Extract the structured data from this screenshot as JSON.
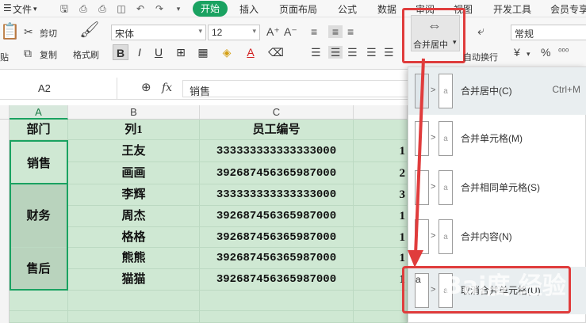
{
  "menu": {
    "file": "文件",
    "tabs": [
      "开始",
      "插入",
      "页面布局",
      "公式",
      "数据",
      "审阅",
      "视图",
      "开发工具",
      "会员专享"
    ]
  },
  "ribbon": {
    "cut": "剪切",
    "paste": "贴",
    "copy": "复制",
    "format_painter": "格式刷",
    "font_name": "宋体",
    "font_size": "12",
    "bold": "B",
    "italic": "I",
    "underline": "U",
    "merge_center": "合并居中",
    "auto_wrap": "自动换行",
    "number_format": "常规",
    "currency": "¥",
    "percent": "%"
  },
  "formula_bar": {
    "name_box": "A2",
    "fx": "fx",
    "content": "销售"
  },
  "columns": [
    "A",
    "B",
    "C"
  ],
  "table": {
    "headers": [
      "部门",
      "列1",
      "员工编号"
    ],
    "groups": [
      "销售",
      "财务",
      "售后"
    ],
    "names": [
      "王友",
      "画画",
      "李辉",
      "周杰",
      "格格",
      "熊熊",
      "猫猫"
    ],
    "ids": [
      "333333333333333000",
      "392687456365987000",
      "333333333333333000",
      "392687456365987000",
      "392687456365987000",
      "392687456365987000",
      "392687456365987000"
    ],
    "col_d_partial": [
      "1",
      "2",
      "3",
      "1",
      "1",
      "1",
      "1"
    ]
  },
  "dropdown": {
    "items": [
      {
        "label": "合并居中(C)",
        "shortcut": "Ctrl+M"
      },
      {
        "label": "合并单元格(M)",
        "shortcut": ""
      },
      {
        "label": "合并相同单元格(S)",
        "shortcut": ""
      },
      {
        "label": "合并内容(N)",
        "shortcut": ""
      },
      {
        "label": "取消合并单元格(U)",
        "shortcut": ""
      }
    ]
  },
  "watermark": "Bai度 经验",
  "colors": {
    "accent": "#1aa261",
    "cell_fill": "#cfe8d3",
    "highlight_red": "#e03c3c"
  }
}
